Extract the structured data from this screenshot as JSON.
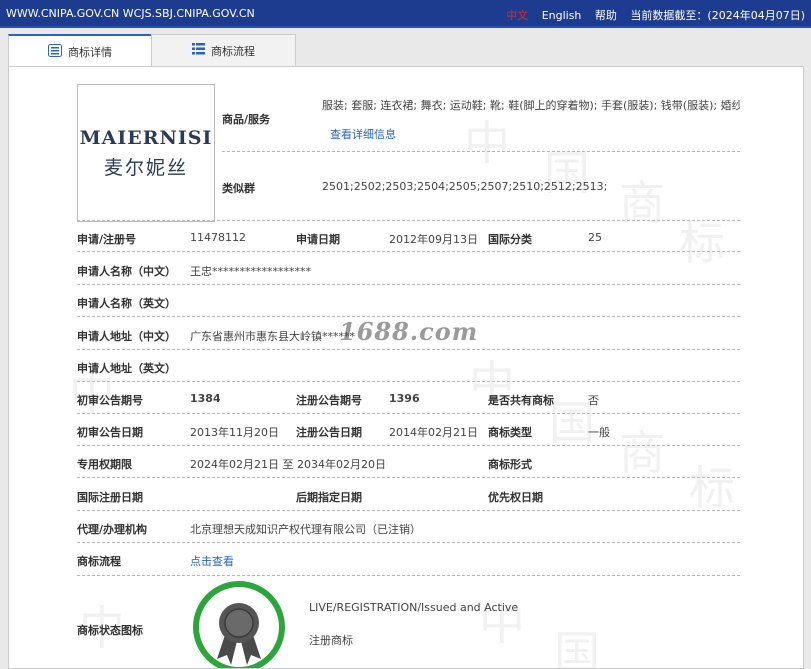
{
  "topbar": {
    "urls": "WWW.CNIPA.GOV.CN WCJS.SBJ.CNIPA.GOV.CN",
    "lang_cn": "中文",
    "lang_en": "English",
    "help": "帮助",
    "data_date": "当前数据截至：(2024年04月07日)"
  },
  "tabs": [
    {
      "label": "商标详情",
      "icon": "list-icon",
      "active": true
    },
    {
      "label": "商标流程",
      "icon": "flow-list-icon",
      "active": false
    }
  ],
  "trademark": {
    "logo_en": "MAIERNISI",
    "logo_cn": "麦尔妮丝",
    "goods_label": "商品/服务",
    "goods_value": "服装; 套服; 连衣裙; 舞衣; 运动鞋; 靴; 鞋(脚上的穿着物); 手套(服装); 钱带(服装); 婚纱",
    "goods_link": "查看详细信息",
    "similar_label": "类似群",
    "similar_value": "2501;2502;2503;2504;2505;2507;2510;2512;2513;",
    "reg_no_label": "申请/注册号",
    "reg_no": "11478112",
    "apply_date_label": "申请日期",
    "apply_date": "2012年09月13日",
    "intl_class_label": "国际分类",
    "intl_class": "25",
    "applicant_cn_label": "申请人名称（中文）",
    "applicant_cn": "王忠******************",
    "applicant_en_label": "申请人名称（英文）",
    "address_cn_label": "申请人地址（中文）",
    "address_cn": "广东省惠州市惠东县大岭镇******",
    "address_en_label": "申请人地址（英文）",
    "prelim_no_label": "初审公告期号",
    "prelim_no": "1384",
    "reg_pub_no_label": "注册公告期号",
    "reg_pub_no": "1396",
    "shared_label": "是否共有商标",
    "shared": "否",
    "prelim_date_label": "初审公告日期",
    "prelim_date": "2013年11月20日",
    "reg_pub_date_label": "注册公告日期",
    "reg_pub_date": "2014年02月21日",
    "type_label": "商标类型",
    "type": "一般",
    "validity_label": "专用权期限",
    "validity": "2024年02月21日 至 2034年02月20日",
    "form_label": "商标形式",
    "intl_reg_date_label": "国际注册日期",
    "later_date_label": "后期指定日期",
    "priority_date_label": "优先权日期",
    "agent_label": "代理/办理机构",
    "agent": "北京理想天成知识产权代理有限公司（已注销）",
    "flow_label": "商标流程",
    "flow_link": "点击查看",
    "status_label": "商标状态图标",
    "status_en": "LIVE/REGISTRATION/Issued and Active",
    "status_cn": "注册商标"
  },
  "watermark": {
    "site": "1688.com",
    "glyphs": [
      "中",
      "国",
      "商",
      "标"
    ]
  },
  "colors": {
    "topbar": "#1e3c8f",
    "link": "#2a63c8",
    "status_ring": "#2aa63a"
  }
}
